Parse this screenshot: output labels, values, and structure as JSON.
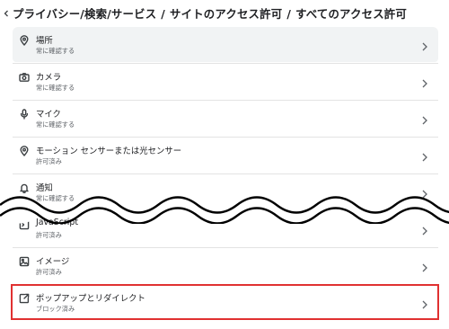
{
  "breadcrumb": {
    "parts": [
      "プライバシー/検索/サービス",
      "/",
      "サイトのアクセス許可",
      "/",
      "すべてのアクセス許可"
    ]
  },
  "permissions": [
    {
      "icon": "location-icon",
      "label": "場所",
      "status": "常に確認する"
    },
    {
      "icon": "camera-icon",
      "label": "カメラ",
      "status": "常に確認する"
    },
    {
      "icon": "microphone-icon",
      "label": "マイク",
      "status": "常に確認する"
    },
    {
      "icon": "motion-sensor-icon",
      "label": "モーション センサーまたは光センサー",
      "status": "許可済み"
    },
    {
      "icon": "bell-icon",
      "label": "通知",
      "status": "常に確認する"
    },
    {
      "icon": "javascript-icon",
      "label": "JavaScript",
      "status": "許可済み"
    },
    {
      "icon": "image-icon",
      "label": "イメージ",
      "status": "許可済み"
    },
    {
      "icon": "popup-icon",
      "label": "ポップアップとリダイレクト",
      "status": "ブロック済み"
    }
  ],
  "colors": {
    "highlight_border": "#e03131",
    "hover_background": "#f1f3f4"
  }
}
